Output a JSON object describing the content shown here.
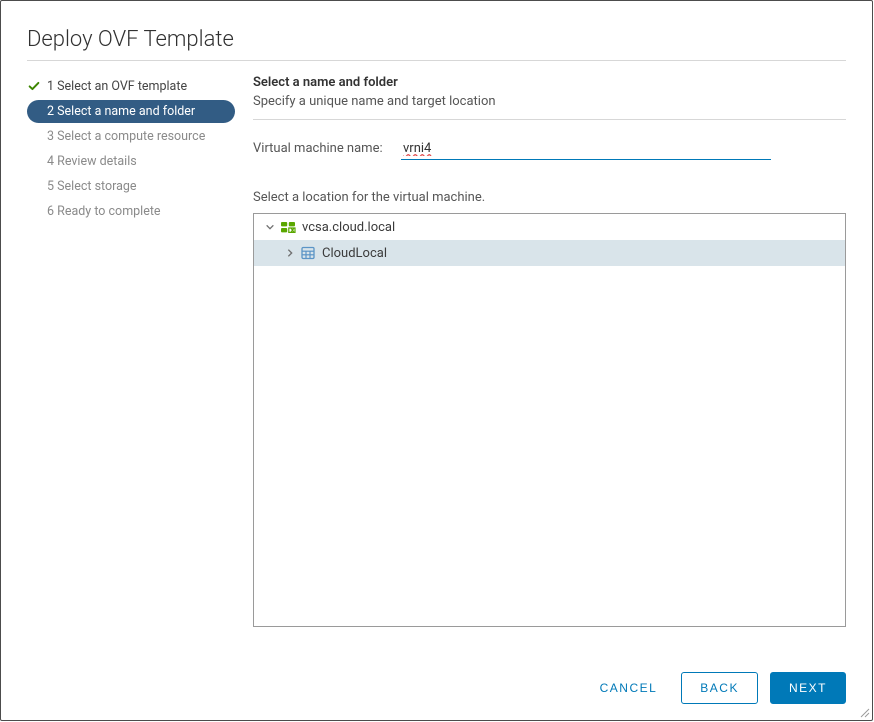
{
  "dialog": {
    "title": "Deploy OVF Template"
  },
  "steps": [
    {
      "label": "1 Select an OVF template",
      "state": "done"
    },
    {
      "label": "2 Select a name and folder",
      "state": "active"
    },
    {
      "label": "3 Select a compute resource",
      "state": "future"
    },
    {
      "label": "4 Review details",
      "state": "future"
    },
    {
      "label": "5 Select storage",
      "state": "future"
    },
    {
      "label": "6 Ready to complete",
      "state": "future"
    }
  ],
  "main": {
    "section_title": "Select a name and folder",
    "section_sub": "Specify a unique name and target location",
    "vm_name_label": "Virtual machine name:",
    "vm_name_value": "vrni4",
    "location_label": "Select a location for the virtual machine.",
    "tree": {
      "root": {
        "label": "vcsa.cloud.local",
        "icon": "vcenter",
        "expanded": true
      },
      "child": {
        "label": "CloudLocal",
        "icon": "datacenter",
        "expanded": false,
        "selected": true
      }
    }
  },
  "footer": {
    "cancel": "CANCEL",
    "back": "BACK",
    "next": "NEXT"
  }
}
